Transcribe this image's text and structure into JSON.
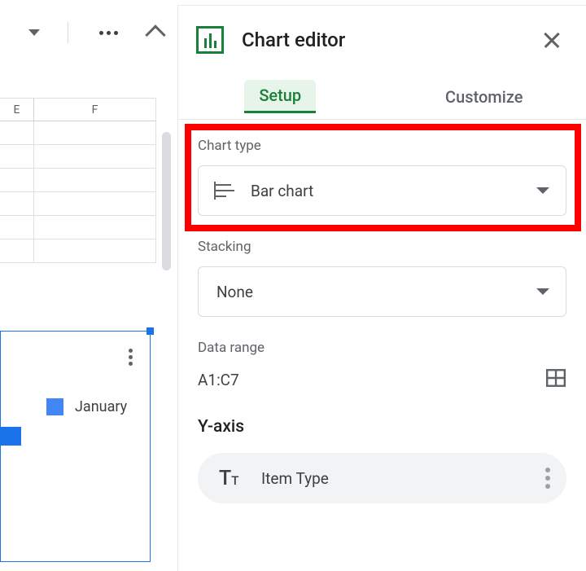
{
  "editor": {
    "title": "Chart editor",
    "tabs": {
      "setup": "Setup",
      "customize": "Customize"
    }
  },
  "setup": {
    "chart_type": {
      "label": "Chart type",
      "value": "Bar chart"
    },
    "stacking": {
      "label": "Stacking",
      "value": "None"
    },
    "data_range": {
      "label": "Data range",
      "value": "A1:C7"
    },
    "y_axis": {
      "section": "Y-axis",
      "item": "Item Type"
    }
  },
  "sheet": {
    "columns": [
      "E",
      "F"
    ]
  },
  "chart_object": {
    "legend": "January"
  }
}
